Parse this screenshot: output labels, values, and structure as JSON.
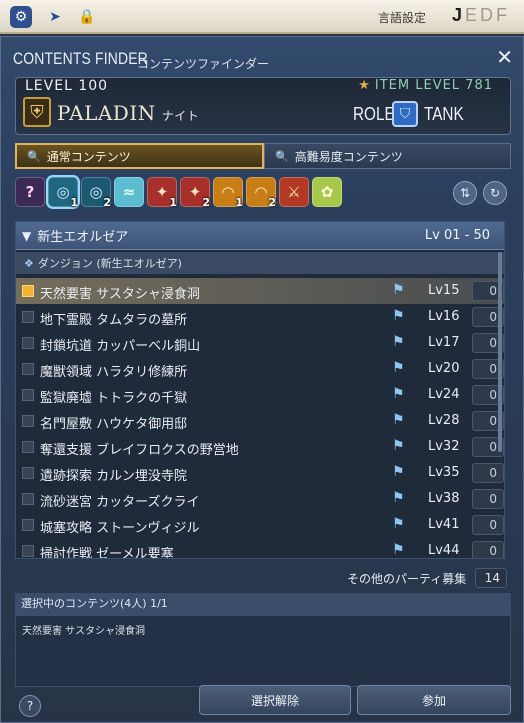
{
  "topbar": {
    "icons": [
      "gear-icon",
      "cursor-icon",
      "lock-icon"
    ],
    "lang_label": "言語設定",
    "lang_keys": [
      "J",
      "E",
      "D",
      "F"
    ],
    "lang_selected": "J"
  },
  "window": {
    "title": "CONTENTS FINDER",
    "subtitle": "コンテンツファインダー",
    "close_icon": "close-icon"
  },
  "character": {
    "level": "LEVEL 100",
    "item_level": "ITEM LEVEL 781",
    "job": "PALADIN",
    "job_jp": "ナイト",
    "role_label": "ROLE",
    "role_value": "TANK"
  },
  "tabs": [
    {
      "label": "通常コンテンツ",
      "active": true
    },
    {
      "label": "高難易度コンテンツ",
      "active": false
    }
  ],
  "categories": [
    {
      "icon": "question-icon",
      "num": ""
    },
    {
      "icon": "dungeon-icon",
      "num": "1",
      "selected": true
    },
    {
      "icon": "dungeon-icon",
      "num": "2"
    },
    {
      "icon": "guildhest-icon",
      "num": ""
    },
    {
      "icon": "trial-icon",
      "num": "1"
    },
    {
      "icon": "trial-icon",
      "num": "2"
    },
    {
      "icon": "raid-icon",
      "num": "1"
    },
    {
      "icon": "raid-icon",
      "num": "2"
    },
    {
      "icon": "pvp-icon",
      "num": ""
    },
    {
      "icon": "gold-saucer-icon",
      "num": ""
    }
  ],
  "list": {
    "group": "新生エオルゼア",
    "range": "Lv 01 - 50",
    "subgroup": "ダンジョン (新生エオルゼア)",
    "rows": [
      {
        "name": "天然要害 サスタシャ浸食洞",
        "lv": "Lv15",
        "count": "0",
        "selected": true
      },
      {
        "name": "地下霊殿 タムタラの墓所",
        "lv": "Lv16",
        "count": "0"
      },
      {
        "name": "封鎖坑道 カッパーベル銅山",
        "lv": "Lv17",
        "count": "0"
      },
      {
        "name": "魔獣領域 ハラタリ修練所",
        "lv": "Lv20",
        "count": "0"
      },
      {
        "name": "監獄廃墟 トトラクの千獄",
        "lv": "Lv24",
        "count": "0"
      },
      {
        "name": "名門屋敷 ハウケタ御用邸",
        "lv": "Lv28",
        "count": "0"
      },
      {
        "name": "奪還支援 ブレイフロクスの野営地",
        "lv": "Lv32",
        "count": "0"
      },
      {
        "name": "遺跡探索 カルン埋没寺院",
        "lv": "Lv35",
        "count": "0"
      },
      {
        "name": "流砂迷宮 カッターズクライ",
        "lv": "Lv38",
        "count": "0"
      },
      {
        "name": "城塞攻略 ストーンヴィジル",
        "lv": "Lv41",
        "count": "0"
      },
      {
        "name": "掃討作戦 ゼーメル要塞",
        "lv": "Lv44",
        "count": "0"
      }
    ]
  },
  "party": {
    "label": "その他のパーティ募集",
    "count": "14"
  },
  "selection": {
    "header": "選択中のコンテンツ(4人) 1/1",
    "item": "天然要害 サスタシャ浸食洞"
  },
  "buttons": {
    "clear": "選択解除",
    "join": "参加",
    "help": "?"
  }
}
